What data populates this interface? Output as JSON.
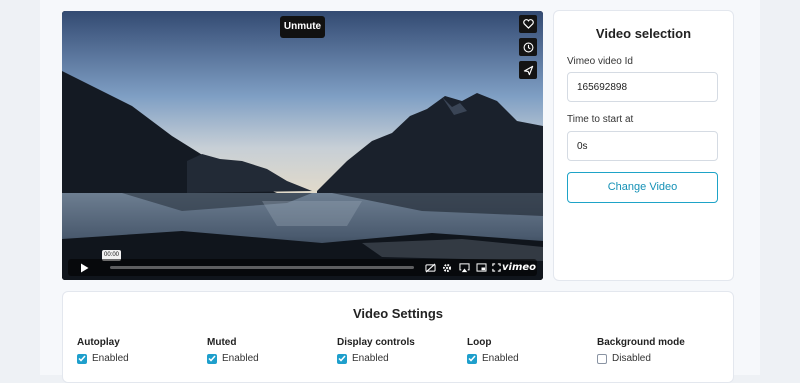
{
  "player": {
    "unmute_label": "Unmute",
    "current_time": "00:00",
    "progress": 0,
    "logo_text": "vimeo",
    "side_icons": [
      "heart-icon",
      "clock-icon",
      "send-icon"
    ],
    "control_icons": [
      "play-icon",
      "captions-off-icon",
      "gear-icon",
      "airplay-icon",
      "pip-icon",
      "fullscreen-icon"
    ]
  },
  "selection": {
    "title": "Video selection",
    "video_id_label": "Vimeo video Id",
    "video_id_value": "165692898",
    "start_label": "Time to start at",
    "start_value": "0s",
    "change_button": "Change Video"
  },
  "settings": {
    "title": "Video Settings",
    "items": [
      {
        "label": "Autoplay",
        "state": "Enabled",
        "checked": true
      },
      {
        "label": "Muted",
        "state": "Enabled",
        "checked": true
      },
      {
        "label": "Display controls",
        "state": "Enabled",
        "checked": true
      },
      {
        "label": "Loop",
        "state": "Enabled",
        "checked": true
      },
      {
        "label": "Background mode",
        "state": "Disabled",
        "checked": false
      }
    ]
  },
  "colors": {
    "accent": "#1ea3c7",
    "checkbox_on": "#1e9fcc"
  }
}
